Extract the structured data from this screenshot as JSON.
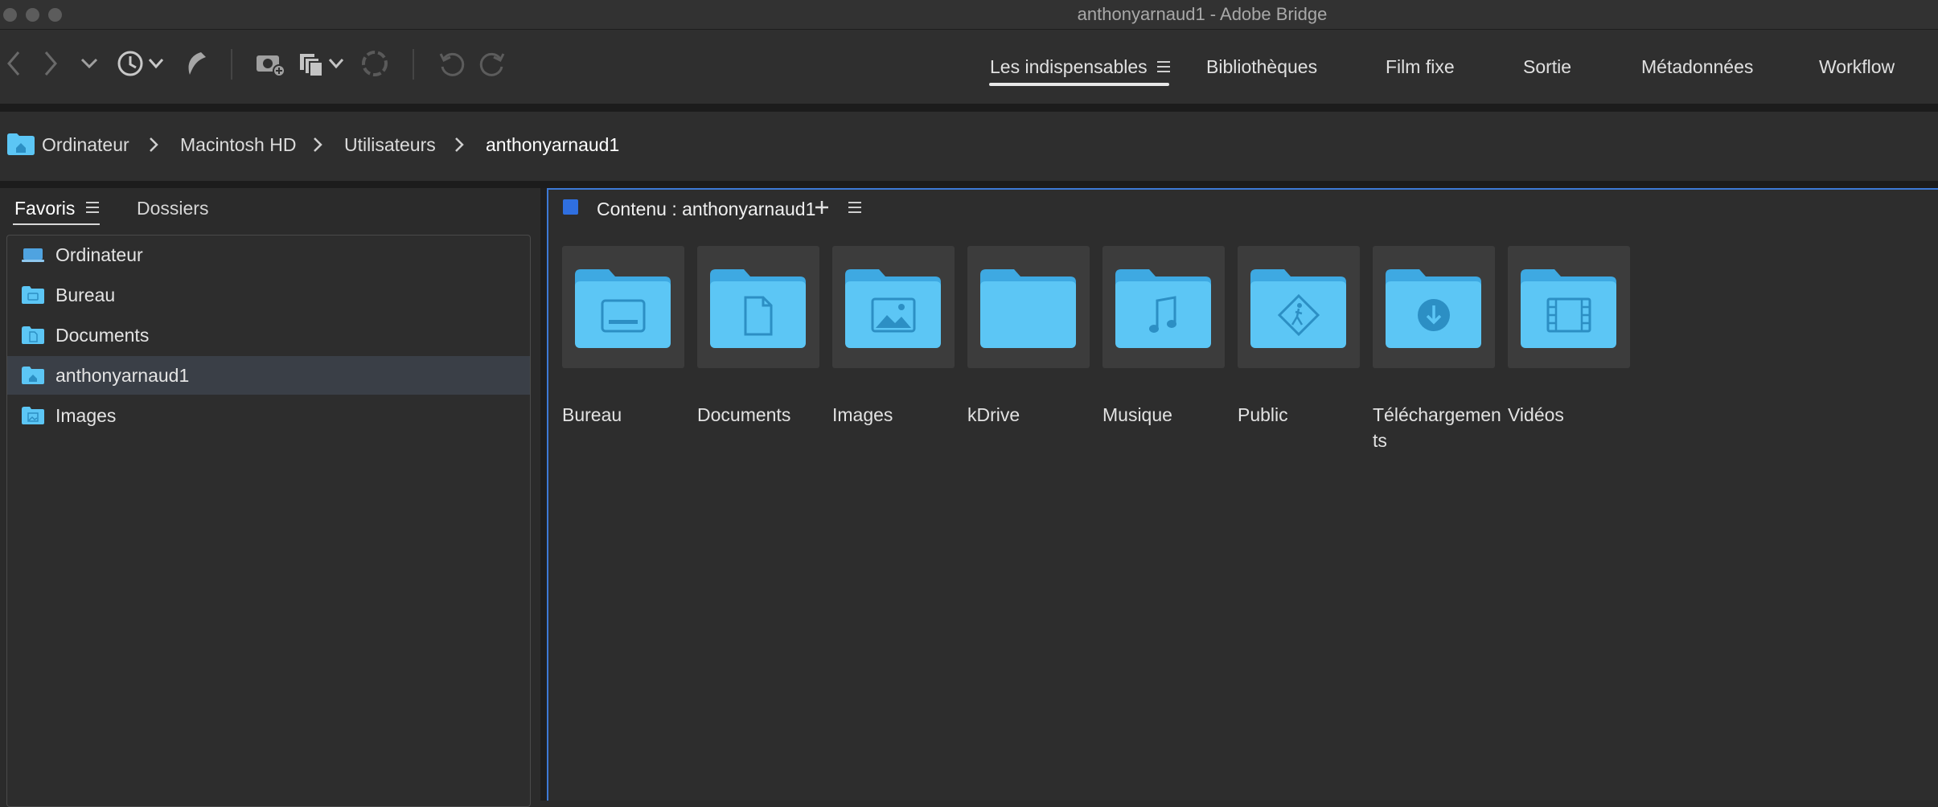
{
  "window": {
    "title": "anthonyarnaud1 - Adobe Bridge"
  },
  "workspaces": [
    {
      "label": "Les indispensables",
      "active": true
    },
    {
      "label": "Bibliothèques"
    },
    {
      "label": "Film fixe"
    },
    {
      "label": "Sortie"
    },
    {
      "label": "Métadonnées"
    },
    {
      "label": "Workflow"
    }
  ],
  "breadcrumb": [
    "Ordinateur",
    "Macintosh HD",
    "Utilisateurs",
    "anthonyarnaud1"
  ],
  "left_panel": {
    "tabs": [
      {
        "label": "Favoris",
        "active": true
      },
      {
        "label": "Dossiers"
      }
    ],
    "favorites": [
      {
        "label": "Ordinateur",
        "icon": "computer-icon"
      },
      {
        "label": "Bureau",
        "icon": "folder-desktop-icon"
      },
      {
        "label": "Documents",
        "icon": "folder-documents-icon"
      },
      {
        "label": "anthonyarnaud1",
        "icon": "folder-home-icon",
        "selected": true
      },
      {
        "label": "Images",
        "icon": "folder-images-icon"
      }
    ]
  },
  "content": {
    "title": "Contenu : anthonyarnaud1",
    "items": [
      {
        "label": "Bureau",
        "icon": "folder-desktop-icon"
      },
      {
        "label": "Documents",
        "icon": "folder-documents-icon"
      },
      {
        "label": "Images",
        "icon": "folder-images-icon"
      },
      {
        "label": "kDrive",
        "icon": "folder-icon"
      },
      {
        "label": "Musique",
        "icon": "folder-music-icon"
      },
      {
        "label": "Public",
        "icon": "folder-public-icon"
      },
      {
        "label": "Téléchargements",
        "icon": "folder-downloads-icon"
      },
      {
        "label": "Vidéos",
        "icon": "folder-videos-icon"
      }
    ]
  },
  "colors": {
    "accent": "#3d7ad6",
    "folder": "#5cc6f5",
    "background": "#2b2b2b"
  }
}
